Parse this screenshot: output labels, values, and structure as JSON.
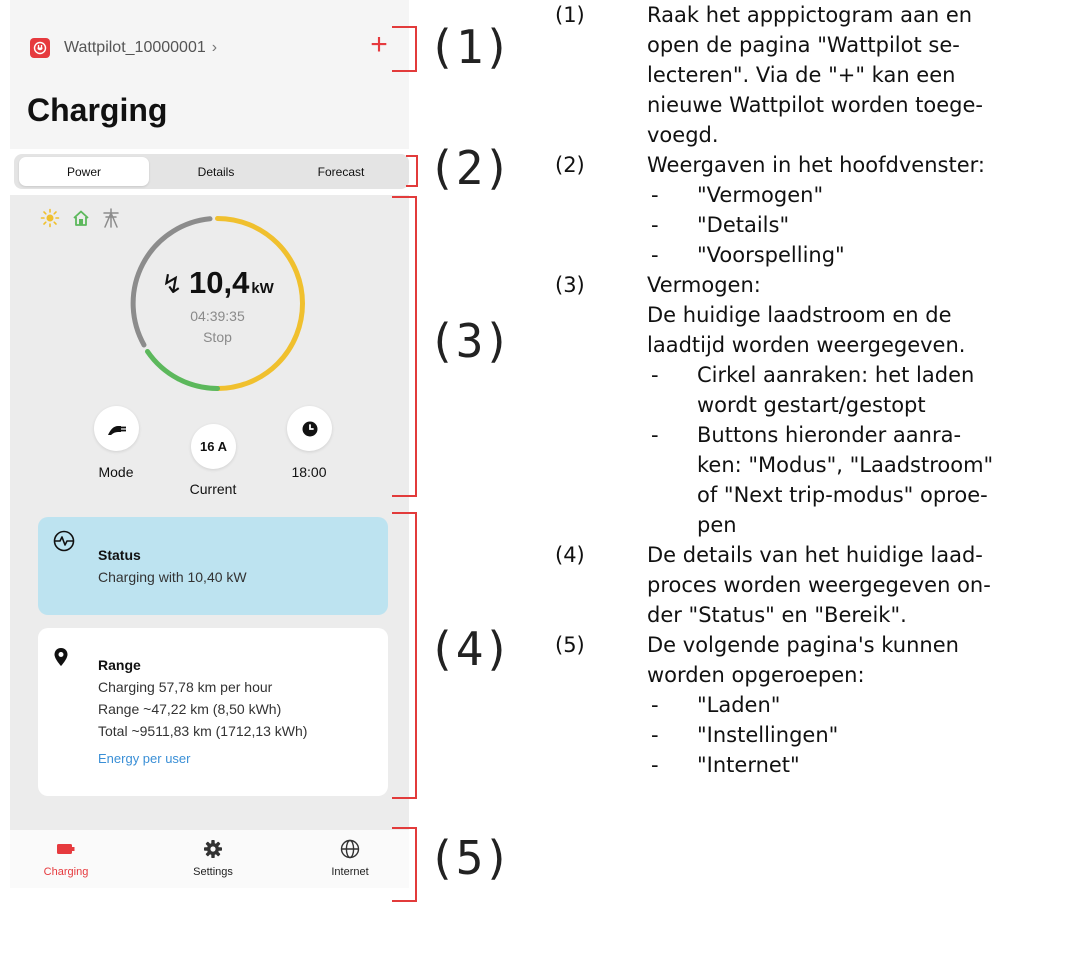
{
  "colors": {
    "accent": "#e63a3e",
    "status_bg": "#bde3f0",
    "link": "#3a8fd6",
    "ring_gray": "#8c8c8c",
    "ring_yellow": "#f0c02e",
    "ring_green": "#5cb85c",
    "callout": "#e23b3b"
  },
  "app": {
    "device_name": "Wattpilot_10000001",
    "add_label": "+",
    "title": "Charging"
  },
  "tabs": [
    {
      "label": "Power",
      "active": true
    },
    {
      "label": "Details",
      "active": false
    },
    {
      "label": "Forecast",
      "active": false
    }
  ],
  "sources": [
    "sun-icon",
    "house-icon",
    "grid-icon"
  ],
  "gauge": {
    "value": "10,4",
    "unit": "kW",
    "time": "04:39:35",
    "action": "Stop"
  },
  "controls": {
    "mode_label": "Mode",
    "current_value": "16 A",
    "current_label": "Current",
    "trip_label": "18:00"
  },
  "status": {
    "title": "Status",
    "text": "Charging with 10,40 kW"
  },
  "range": {
    "title": "Range",
    "lines": [
      "Charging 57,78 km per hour",
      "Range ~47,22 km (8,50 kWh)",
      "Total ~9511,83 km (1712,13 kWh)"
    ],
    "link": "Energy per user"
  },
  "nav": [
    {
      "label": "Charging",
      "icon": "battery-icon",
      "active": true
    },
    {
      "label": "Settings",
      "icon": "gear-icon",
      "active": false
    },
    {
      "label": "Internet",
      "icon": "globe-icon",
      "active": false
    }
  ],
  "callouts": [
    "(1)",
    "(2)",
    "(3)",
    "(4)",
    "(5)"
  ],
  "description": {
    "e1": {
      "num": "(1)",
      "lines": [
        "Raak het apppictogram aan en",
        "open de pagina \"Wattpilot se-",
        "lecteren\". Via de \"+\" kan een",
        "nieuwe Wattpilot worden toege-",
        "voegd."
      ]
    },
    "e2": {
      "num": "(2)",
      "lines": [
        "Weergaven in het hoofdvenster:"
      ],
      "bullets": [
        "\"Vermogen\"",
        "\"Details\"",
        "\"Voorspelling\""
      ]
    },
    "e3": {
      "num": "(3)",
      "lines": [
        "Vermogen:",
        "De huidige laadstroom en de",
        "laadtijd worden weergegeven."
      ],
      "bullets": [
        [
          "Cirkel aanraken: het laden",
          "wordt gestart/gestopt"
        ],
        [
          "Buttons hieronder aanra-",
          "ken: \"Modus\", \"Laadstroom\"",
          "of \"Next trip-modus\" oproe-",
          "pen"
        ]
      ]
    },
    "e4": {
      "num": "(4)",
      "lines": [
        "De details van het huidige laad-",
        "proces worden weergegeven on-",
        "der \"Status\" en \"Bereik\"."
      ]
    },
    "e5": {
      "num": "(5)",
      "lines": [
        "De volgende pagina's kunnen",
        "worden opgeroepen:"
      ],
      "bullets": [
        "\"Laden\"",
        "\"Instellingen\"",
        "\"Internet\""
      ]
    }
  }
}
